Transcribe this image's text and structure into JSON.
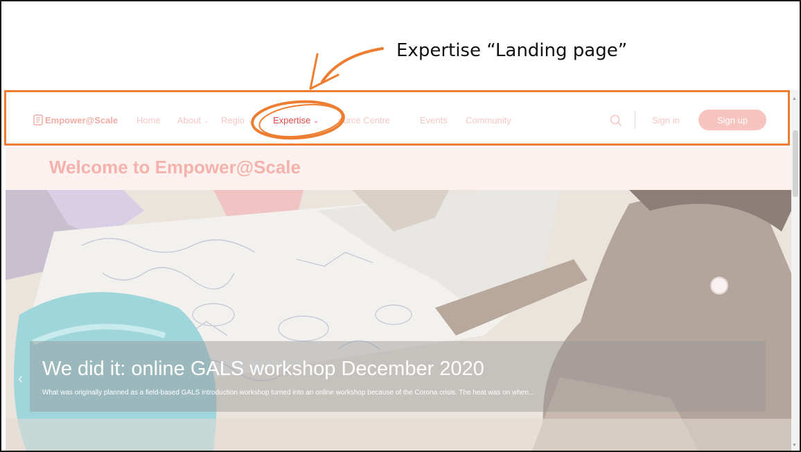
{
  "annotation": {
    "label": "Expertise “Landing page”",
    "accent_color": "#ed7d31"
  },
  "navbar": {
    "brand": "Empower@Scale",
    "items": [
      {
        "label": "Home",
        "has_dropdown": false
      },
      {
        "label": "About",
        "has_dropdown": true
      },
      {
        "label": "Regio",
        "has_dropdown": true
      },
      {
        "label": "Expertise",
        "has_dropdown": true,
        "active": true
      },
      {
        "label": "ource Centre",
        "has_dropdown": false
      },
      {
        "label": "Events",
        "has_dropdown": false
      },
      {
        "label": "Community",
        "has_dropdown": false
      }
    ],
    "search_icon": "search-icon",
    "sign_in": "Sign in",
    "sign_up": "Sign up",
    "brand_color": "#f0aca5",
    "active_color": "#e04848"
  },
  "welcome": {
    "title": "Welcome to Empower@Scale"
  },
  "hero": {
    "slide_title": "We did it: online GALS workshop December 2020",
    "slide_text": "What was originally planned as a field-based GALS introduction workshop turned into an online workshop because of the Corona crisis. The heat was on when...",
    "prev_icon": "chevron-left-icon"
  }
}
